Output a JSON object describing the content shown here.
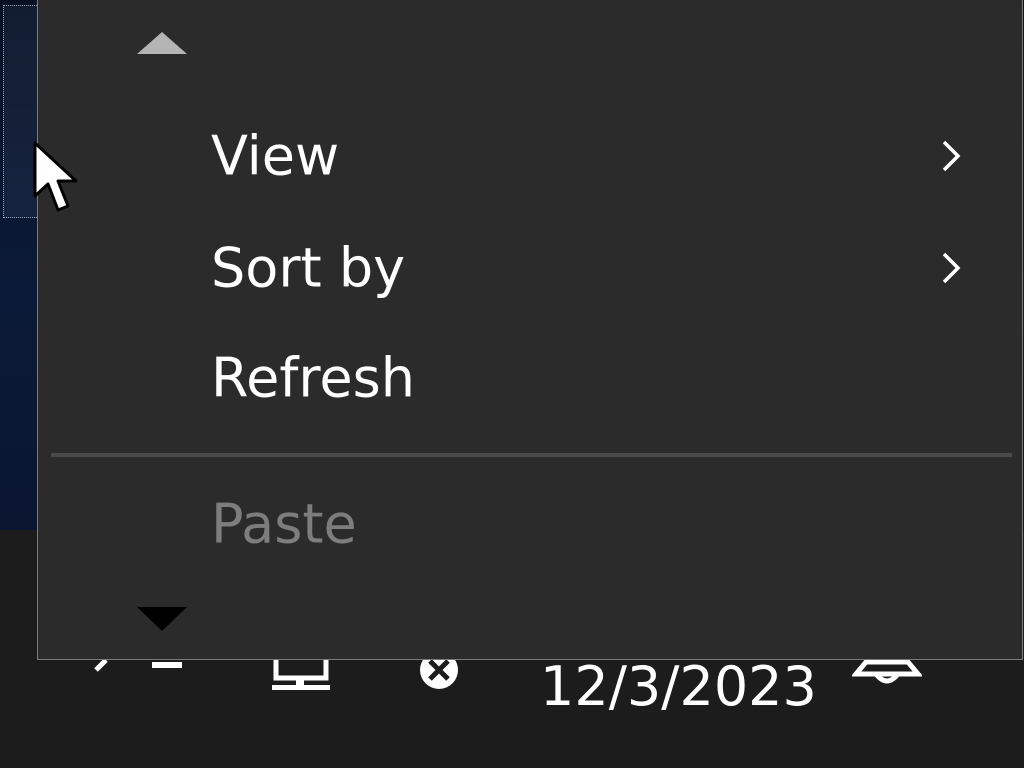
{
  "taskbar": {
    "clock_date": "12/3/2023",
    "icons": [
      "chevron-up-icon",
      "network-icon",
      "volume-muted-icon",
      "notification-bell-icon"
    ]
  },
  "context_menu": {
    "scroll_up_icon": "triangle-up-icon",
    "scroll_down_icon": "triangle-down-icon",
    "items": [
      {
        "label": "View",
        "has_submenu": true,
        "enabled": true,
        "submenu_icon": "chevron-right-icon"
      },
      {
        "label": "Sort by",
        "has_submenu": true,
        "enabled": true,
        "submenu_icon": "chevron-right-icon"
      },
      {
        "label": "Refresh",
        "has_submenu": false,
        "enabled": true
      },
      {
        "label": "Paste",
        "has_submenu": false,
        "enabled": false
      }
    ]
  },
  "colors": {
    "menu_background": "#2b2b2b",
    "menu_text": "#ffffff",
    "disabled_text": "#7d7d7d",
    "taskbar_background": "#1c1c1c",
    "desktop_background": "#0b1a38"
  }
}
